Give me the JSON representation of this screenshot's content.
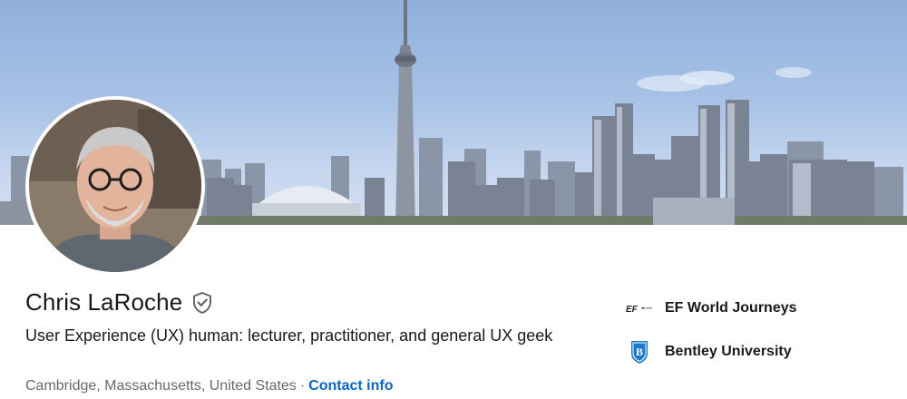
{
  "profile": {
    "name": "Chris LaRoche",
    "headline": "User Experience (UX) human: lecturer, practitioner, and general UX geek",
    "location": "Cambridge, Massachusetts, United States",
    "separator": "·",
    "contact_label": "Contact info"
  },
  "organizations": [
    {
      "name": "EF World Journeys",
      "logo": "ef-logo-icon",
      "logo_text": "EF"
    },
    {
      "name": "Bentley University",
      "logo": "bentley-shield-icon",
      "logo_text": "B"
    }
  ],
  "colors": {
    "link": "#0a66c2",
    "text_primary": "#000000e6",
    "text_secondary": "#00000099",
    "bentley_blue": "#1f78c8"
  }
}
